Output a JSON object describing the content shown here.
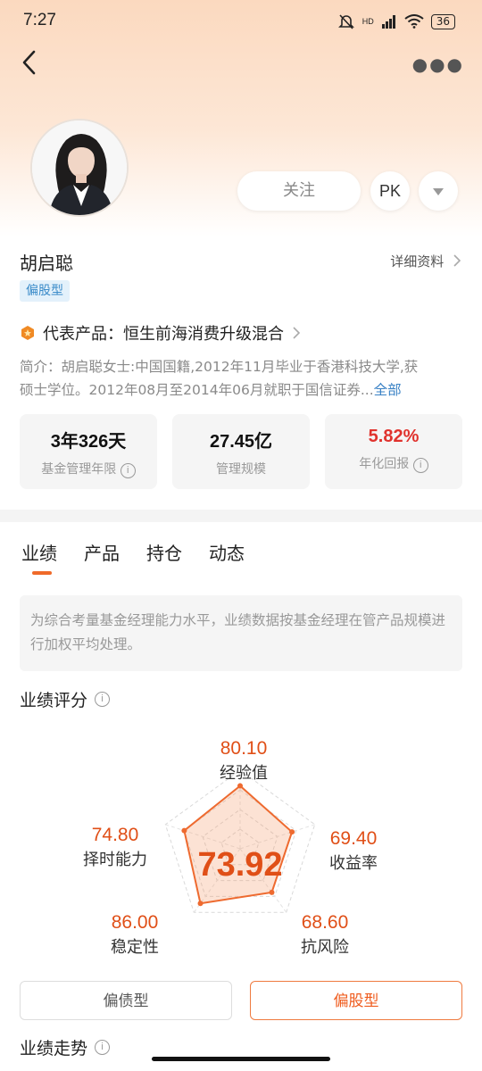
{
  "status_bar": {
    "time": "7:27",
    "network": "HD",
    "battery": "36"
  },
  "header": {
    "follow_label": "关注",
    "pk_label": "PK"
  },
  "manager": {
    "name": "胡启聪",
    "detail_link": "详细资料",
    "type_tag": "偏股型",
    "rep_prefix": "代表产品：",
    "rep_product": "恒生前海消费升级混合",
    "intro_line1": "简介：胡启聪女士:中国国籍,2012年11月毕业于香港科技大学,获",
    "intro_line2": "硕士学位。2012年08月至2014年06月就职于国信证券...",
    "intro_more": "全部"
  },
  "stats": [
    {
      "value": "3年326天",
      "label": "基金管理年限",
      "has_info": true
    },
    {
      "value": "27.45亿",
      "label": "管理规模",
      "has_info": false
    },
    {
      "value": "5.82%",
      "label": "年化回报",
      "has_info": true
    }
  ],
  "tabs": [
    "业绩",
    "产品",
    "持仓",
    "动态"
  ],
  "note_text": "为综合考量基金经理能力水平，业绩数据按基金经理在管产品规模进行加权平均处理。",
  "performance": {
    "title": "业绩评分",
    "total_score": "73.92",
    "dims": [
      {
        "value": "80.10",
        "label": "经验值",
        "score": 80.1
      },
      {
        "value": "69.40",
        "label": "收益率",
        "score": 69.4
      },
      {
        "value": "68.60",
        "label": "抗风险",
        "score": 68.6
      },
      {
        "value": "86.00",
        "label": "稳定性",
        "score": 86.0
      },
      {
        "value": "74.80",
        "label": "择时能力",
        "score": 74.8
      }
    ]
  },
  "type_buttons": {
    "debt": "偏债型",
    "equity": "偏股型"
  },
  "trend_title": "业绩走势",
  "colors": {
    "accent": "#ef5c1e",
    "red_value": "#e0322d",
    "link": "#3a82c5",
    "tag_bg": "#e3f1fb"
  }
}
